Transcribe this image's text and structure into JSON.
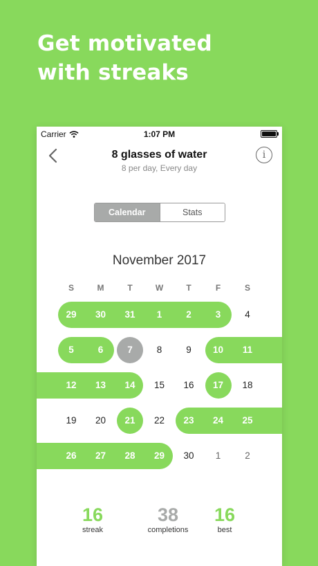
{
  "promo": {
    "line1": "Get motivated",
    "line2": "with streaks"
  },
  "status": {
    "carrier": "Carrier",
    "time": "1:07 PM"
  },
  "header": {
    "title": "8 glasses of water",
    "subtitle": "8 per day, Every day"
  },
  "tabs": {
    "active": "Calendar",
    "inactive": "Stats"
  },
  "calendar": {
    "month": "November 2017",
    "weekdays": [
      "S",
      "M",
      "T",
      "W",
      "T",
      "F",
      "S"
    ],
    "weeks": [
      [
        {
          "d": "29",
          "s": "done"
        },
        {
          "d": "30",
          "s": "done"
        },
        {
          "d": "31",
          "s": "done"
        },
        {
          "d": "1",
          "s": "done"
        },
        {
          "d": "2",
          "s": "done"
        },
        {
          "d": "3",
          "s": "done"
        },
        {
          "d": "4",
          "s": "normal"
        }
      ],
      [
        {
          "d": "5",
          "s": "done"
        },
        {
          "d": "6",
          "s": "done"
        },
        {
          "d": "7",
          "s": "today"
        },
        {
          "d": "8",
          "s": "normal"
        },
        {
          "d": "9",
          "s": "normal"
        },
        {
          "d": "10",
          "s": "done"
        },
        {
          "d": "11",
          "s": "done"
        }
      ],
      [
        {
          "d": "12",
          "s": "done"
        },
        {
          "d": "13",
          "s": "done"
        },
        {
          "d": "14",
          "s": "done"
        },
        {
          "d": "15",
          "s": "normal"
        },
        {
          "d": "16",
          "s": "normal"
        },
        {
          "d": "17",
          "s": "done"
        },
        {
          "d": "18",
          "s": "normal"
        }
      ],
      [
        {
          "d": "19",
          "s": "normal"
        },
        {
          "d": "20",
          "s": "normal"
        },
        {
          "d": "21",
          "s": "done"
        },
        {
          "d": "22",
          "s": "normal"
        },
        {
          "d": "23",
          "s": "done"
        },
        {
          "d": "24",
          "s": "done"
        },
        {
          "d": "25",
          "s": "done"
        }
      ],
      [
        {
          "d": "26",
          "s": "done"
        },
        {
          "d": "27",
          "s": "done"
        },
        {
          "d": "28",
          "s": "done"
        },
        {
          "d": "29",
          "s": "done"
        },
        {
          "d": "30",
          "s": "normal"
        },
        {
          "d": "1",
          "s": "other"
        },
        {
          "d": "2",
          "s": "other"
        }
      ]
    ]
  },
  "stats": [
    {
      "value": "16",
      "label": "streak",
      "color": "#88d95c"
    },
    {
      "value": "38",
      "label": "completions",
      "color": "#a8aaa9"
    },
    {
      "value": "16",
      "label": "best",
      "color": "#88d95c"
    }
  ],
  "colors": {
    "accent": "#88d95c",
    "today": "#a8aaa9"
  },
  "icons": {
    "back": "chevron-left-icon",
    "info": "info-icon",
    "wifi": "wifi-icon",
    "battery": "battery-icon"
  }
}
